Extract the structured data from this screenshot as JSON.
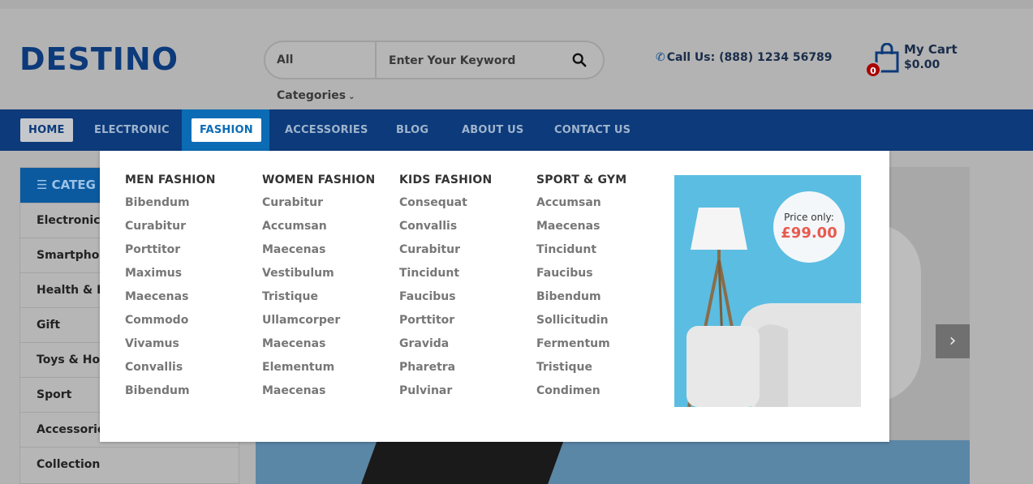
{
  "header": {
    "logo": "DESTINO",
    "search": {
      "category": "All Categories",
      "placeholder": "Enter Your Keyword"
    },
    "call": "Call Us: (888) 1234 56789",
    "cart": {
      "title": "My Cart",
      "amount": "$0.00",
      "count": "0"
    }
  },
  "nav": {
    "items": [
      "HOME",
      "ELECTRONIC",
      "FASHION",
      "ACCESSORIES",
      "BLOG",
      "ABOUT US",
      "CONTACT US"
    ]
  },
  "sidebar": {
    "title": "CATEG",
    "items": [
      "Electronics",
      "Smartphon",
      "Health & Be",
      "Gift",
      "Toys & Hob",
      "Sport",
      "Accessories",
      "Collection"
    ]
  },
  "mega_menu": {
    "columns": [
      {
        "title": "MEN FASHION",
        "items": [
          "Bibendum",
          "Curabitur",
          "Porttitor",
          "Maximus",
          "Maecenas",
          "Commodo",
          "Vivamus",
          "Convallis",
          "Bibendum"
        ]
      },
      {
        "title": "WOMEN FASHION",
        "items": [
          "Curabitur",
          "Accumsan",
          "Maecenas",
          "Vestibulum",
          "Tristique",
          "Ullamcorper",
          "Maecenas",
          "Elementum",
          "Maecenas"
        ]
      },
      {
        "title": "KIDS FASHION",
        "items": [
          "Consequat",
          "Convallis",
          "Curabitur",
          "Tincidunt",
          "Faucibus",
          "Porttitor",
          "Gravida",
          "Pharetra",
          "Pulvinar"
        ]
      },
      {
        "title": "SPORT & GYM",
        "items": [
          "Accumsan",
          "Maecenas",
          "Tincidunt",
          "Faucibus",
          "Bibendum",
          "Sollicitudin",
          "Fermentum",
          "Tristique",
          "Condimen"
        ]
      }
    ],
    "promo": {
      "label": "Price only:",
      "price": "£99.00"
    }
  }
}
